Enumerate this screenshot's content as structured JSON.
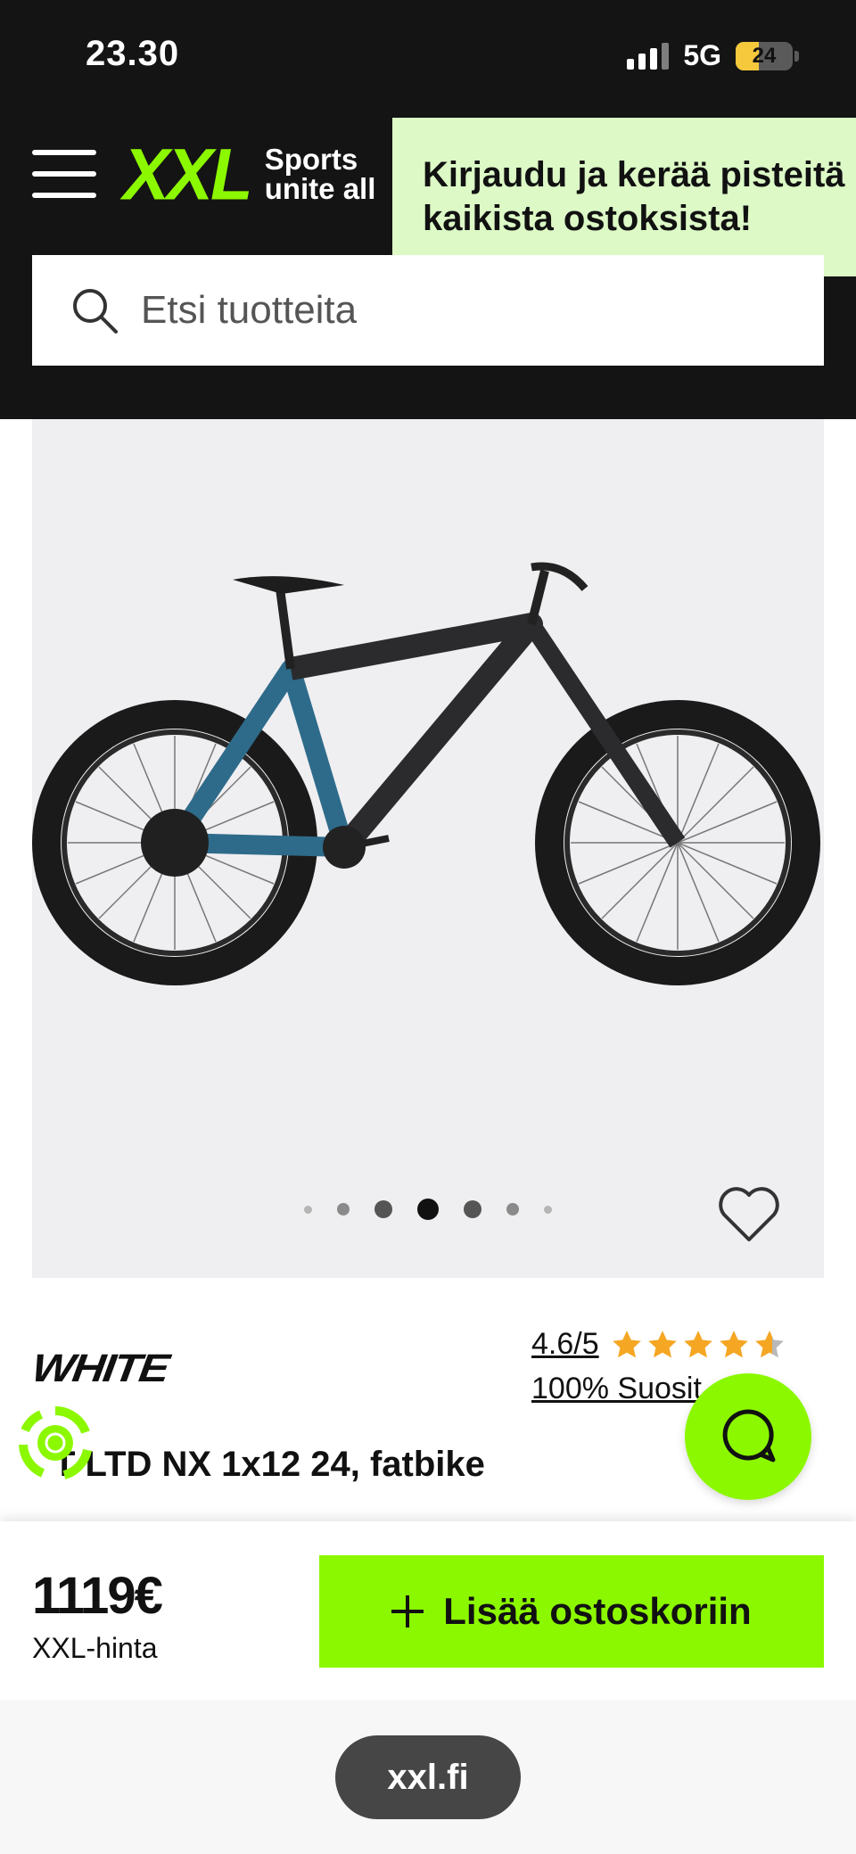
{
  "status_bar": {
    "time": "23.30",
    "network": "5G",
    "battery": "24"
  },
  "header": {
    "logo_text": "XXL",
    "logo_tagline_1": "Sports",
    "logo_tagline_2": "unite all",
    "login_banner_line_1": "Kirjaudu ja kerää pisteitä",
    "login_banner_line_2": "kaikista ostoksista!",
    "search_placeholder": "Etsi tuotteita"
  },
  "gallery": {
    "active_index": 3,
    "total": 7
  },
  "product": {
    "brand": "WHITE",
    "rating": "4.6/5",
    "rating_value": 4.6,
    "recommend": "100% Suosit",
    "title": "T LTD NX 1x12 24, fatbike"
  },
  "buy_bar": {
    "price": "1119€",
    "price_label": "XXL-hinta",
    "add_to_cart": "Lisää ostoskoriin"
  },
  "browser": {
    "url": "xxl.fi"
  },
  "colors": {
    "brand_green": "#8cf800",
    "header_bg": "#141414",
    "banner_bg": "#dcf9c6",
    "star": "#f5a623"
  },
  "icons": [
    "hamburger-menu-icon",
    "search-icon",
    "heart-icon",
    "star-icon",
    "chat-icon",
    "eco-badge-icon",
    "plus-icon"
  ]
}
